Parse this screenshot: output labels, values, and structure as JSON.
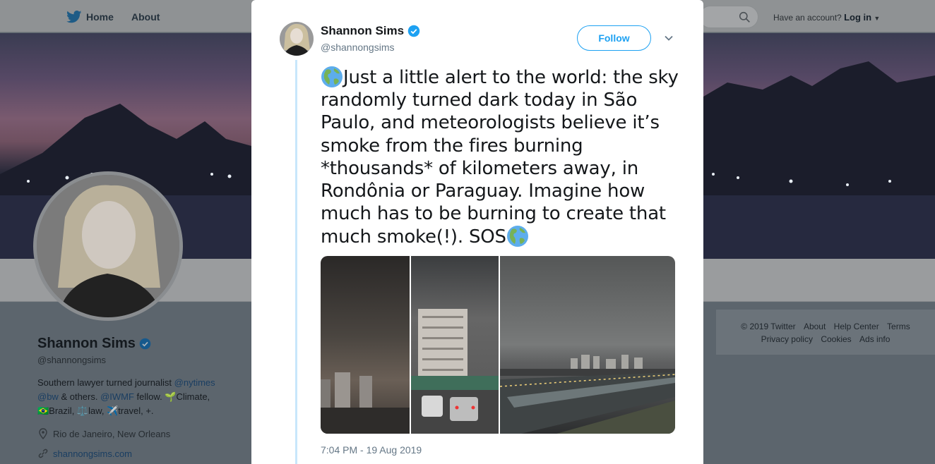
{
  "nav": {
    "home": "Home",
    "about": "About"
  },
  "account": {
    "prompt": "Have an account?",
    "login": "Log in"
  },
  "profile": {
    "name": "Shannon Sims",
    "handle": "@shannongsims",
    "bio": {
      "part1": "Southern lawyer turned journalist ",
      "link1": "@nytimes",
      "link2": "@bw",
      "part2": " & others. ",
      "link3": "@IWMF",
      "part3": " fellow. 🌱Climate,",
      "part4": "🇧🇷Brazil, ⚖️law, ✈️travel, +."
    },
    "location": "Rio de Janeiro, New Orleans",
    "website": "shannongsims.com"
  },
  "footer": {
    "row1": [
      "© 2019 Twitter",
      "About",
      "Help Center",
      "Terms"
    ],
    "row2": [
      "Privacy policy",
      "Cookies",
      "Ads info"
    ]
  },
  "tweet": {
    "author_name": "Shannon Sims",
    "author_handle": "@shannongsims",
    "follow_label": "Follow",
    "text_main": "Just a little alert to the world: the sky randomly turned dark today in São Paulo, and meteorologists believe it’s smoke from the fires burning *thousands* of kilometers away, in Rondônia or Paraguay. Imagine how much has to be burning to create that much smoke(!). SOS",
    "timestamp": "7:04 PM - 19 Aug 2019"
  },
  "icons": {
    "brand": "twitter-bird-icon",
    "search": "search-icon",
    "verified": "verified-badge-icon",
    "location": "location-pin-icon",
    "link": "link-icon",
    "caret": "chevron-down-icon",
    "globe": "globe-americas-icon"
  },
  "colors": {
    "accent": "#1da1f2",
    "thread": "#c8e7fb",
    "muted": "#657786"
  }
}
